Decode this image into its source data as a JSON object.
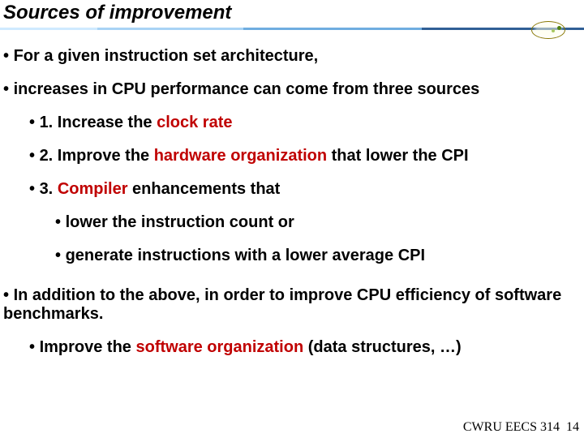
{
  "title": "Sources of improvement",
  "bullets": {
    "l0a": "For a given instruction set architecture,",
    "l0b": "increases in CPU performance can come from three sources",
    "l1_1_pre": "1. Increase the ",
    "l1_1_red": "clock rate",
    "l1_2_pre": "2. Improve the ",
    "l1_2_red": "hardware organization",
    "l1_2_post": " that lower the CPI",
    "l1_3_pre": "3. ",
    "l1_3_red": "Compiler",
    "l1_3_post": " enhancements that",
    "l2_a": "lower the instruction count or",
    "l2_b": "generate instructions with a lower average CPI",
    "l0c": "In addition to the above, in order to improve CPU efficiency of software benchmarks.",
    "l1_4_pre": "Improve the ",
    "l1_4_red": "software organization",
    "l1_4_post": " (data structures, …)"
  },
  "footer": {
    "course": "CWRU EECS 314",
    "page": "14"
  }
}
